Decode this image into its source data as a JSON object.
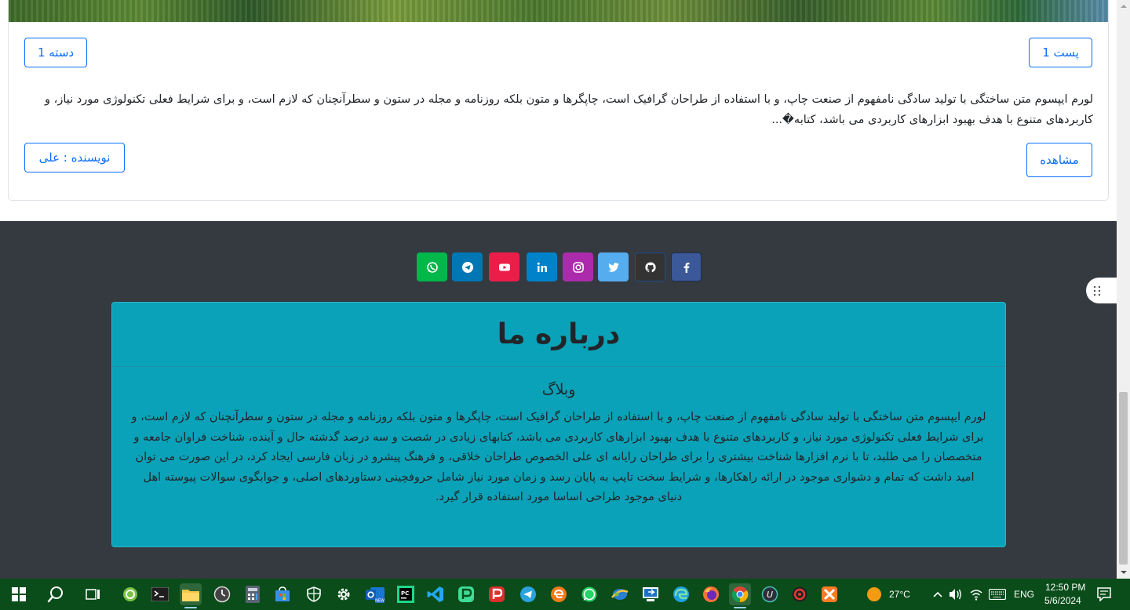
{
  "post": {
    "post_button": "پست 1",
    "category_button": "دسته 1",
    "excerpt": "لورم ایپسوم متن ساختگی با تولید سادگی نامفهوم از صنعت چاپ، و با استفاده از طراحان گرافیک است، چاپگرها و متون بلکه روزنامه و مجله در ستون و سطرآنچنان که لازم است، و برای شرایط فعلی تکنولوژی مورد نیاز، و کاربردهای متنوع با هدف بهبود ابزارهای کاربردی می باشد، کتابه�...",
    "view_button": "مشاهده",
    "author_button": "نویسنده : علی"
  },
  "social": {
    "items": [
      {
        "name": "whatsapp-icon",
        "color": "#25d366"
      },
      {
        "name": "telegram-icon",
        "color": "#0088cc"
      },
      {
        "name": "youtube-icon",
        "color": "#ff0000"
      },
      {
        "name": "linkedin-icon",
        "color": "#0077b5"
      },
      {
        "name": "instagram-icon",
        "color": "#ac2bac"
      },
      {
        "name": "twitter-icon",
        "color": "#55acee"
      },
      {
        "name": "github-icon",
        "color": "#333333"
      },
      {
        "name": "facebook-icon",
        "color": "#3b5998"
      }
    ]
  },
  "about": {
    "title": "درباره ما",
    "subtitle": "وبلاگ",
    "text": "لورم ایپسوم متن ساختگی با تولید سادگی نامفهوم از صنعت چاپ، و با استفاده از طراحان گرافیک است، چاپگرها و متون بلکه روزنامه و مجله در ستون و سطرآنچنان که لازم است، و برای شرایط فعلی تکنولوژی مورد نیاز، و کاربردهای متنوع با هدف بهبود ابزارهای کاربردی می باشد، کتابهای زیادی در شصت و سه درصد گذشته حال و آینده، شناخت فراوان جامعه و متخصصان را می طلبد، تا با نرم افزارها شناخت بیشتری را برای طراحان رایانه ای علی الخصوص طراحان خلاقی، و فرهنگ پیشرو در زبان فارسی ایجاد کرد، در این صورت می توان امید داشت که تمام و دشواری موجود در ارائه راهکارها، و شرایط سخت تایپ به پایان رسد و زمان مورد نیاز شامل حروفچینی دستاوردهای اصلی، و جوابگوی سوالات پیوسته اهل دنیای موجود طراحی اساسا مورد استفاده قرار گیرد."
  },
  "taskbar": {
    "weather": "27°C",
    "language": "ENG",
    "time": "12:50 PM",
    "date": "5/6/2024"
  },
  "colors": {
    "footer_bg": "#343a40",
    "about_bg": "#0aa2b8",
    "primary": "#0d6efd",
    "taskbar_bg": "#0a4d1a"
  }
}
